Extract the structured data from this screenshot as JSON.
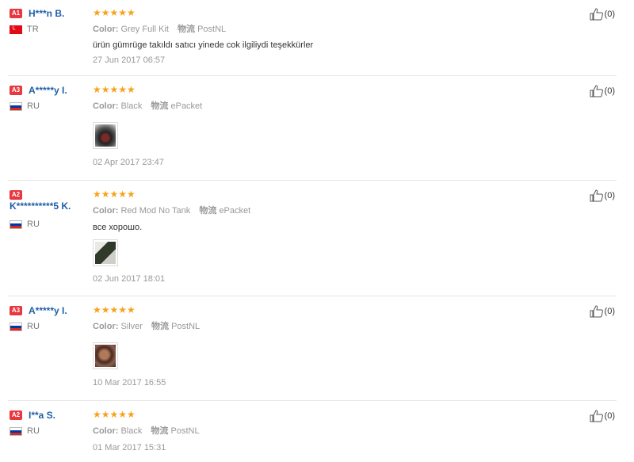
{
  "labels": {
    "color": "Color:",
    "shipping": "物流"
  },
  "reviews": [
    {
      "badge": "A1",
      "name": "H***n B.",
      "country": "TR",
      "flag": "tr",
      "color": "Grey Full Kit",
      "shipping": "PostNL",
      "text": "ürün gümrüge takıldı satıcı yinede cok ilgiliydi teşekkürler",
      "date": "27 Jun 2017 06:57",
      "likes": "(0)",
      "image": null
    },
    {
      "badge": "A3",
      "name": "A*****y I.",
      "country": "RU",
      "flag": "ru",
      "color": "Black",
      "shipping": "ePacket",
      "text": "",
      "date": "02 Apr 2017 23:47",
      "likes": "(0)",
      "image": "photo-1"
    },
    {
      "badge": "A2",
      "name": "K**********5 K.",
      "country": "RU",
      "flag": "ru",
      "color": "Red Mod No Tank",
      "shipping": "ePacket",
      "text": "все хорошо.",
      "date": "02 Jun 2017 18:01",
      "likes": "(0)",
      "image": "photo-2"
    },
    {
      "badge": "A3",
      "name": "A*****y I.",
      "country": "RU",
      "flag": "ru",
      "color": "Silver",
      "shipping": "PostNL",
      "text": "",
      "date": "10 Mar 2017 16:55",
      "likes": "(0)",
      "image": "photo-3"
    },
    {
      "badge": "A2",
      "name": "I**a S.",
      "country": "RU",
      "flag": "ru",
      "color": "Black",
      "shipping": "PostNL",
      "text": "",
      "date": "01 Mar 2017 15:31",
      "likes": "(0)",
      "image": null
    }
  ],
  "colors": {
    "badge": "#e8373f",
    "username": "#1f5fa8",
    "stars": "#f7a21b"
  }
}
